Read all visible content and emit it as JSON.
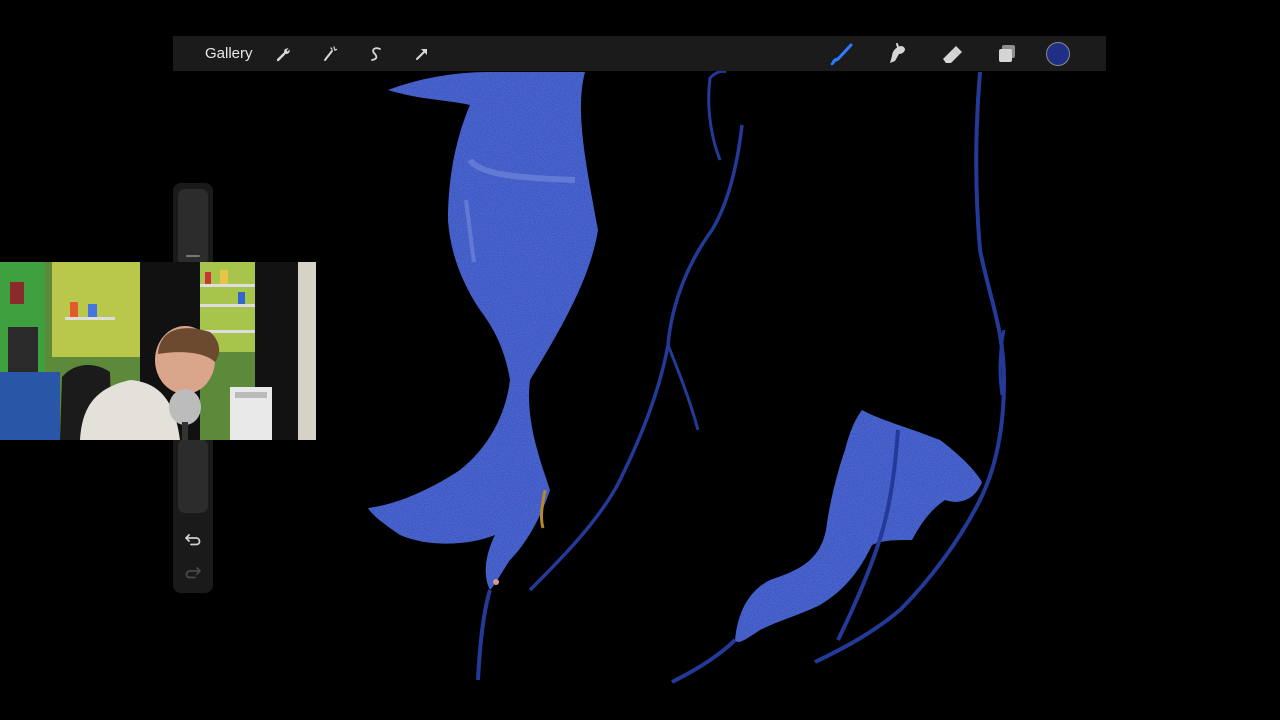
{
  "app": {
    "accent_color": "#2f7bff",
    "current_color": "#1f2f86"
  },
  "toolbar": {
    "gallery_label": "Gallery",
    "left_tools": [
      {
        "name": "actions-wrench-icon"
      },
      {
        "name": "adjustments-magic-wand-icon"
      },
      {
        "name": "selection-s-icon"
      },
      {
        "name": "transform-arrow-icon"
      }
    ],
    "right_tools": [
      {
        "name": "brush-icon",
        "active": true
      },
      {
        "name": "smudge-icon",
        "active": false
      },
      {
        "name": "eraser-icon",
        "active": false
      },
      {
        "name": "layers-icon",
        "active": false
      }
    ]
  },
  "sidebar": {
    "brush_size_slider": "size",
    "opacity_slider": "opacity",
    "undo_icon": "undo-arrow-icon",
    "redo_icon": "redo-arrow-icon"
  },
  "webcam": {
    "description_icon": "webcam-feed"
  }
}
